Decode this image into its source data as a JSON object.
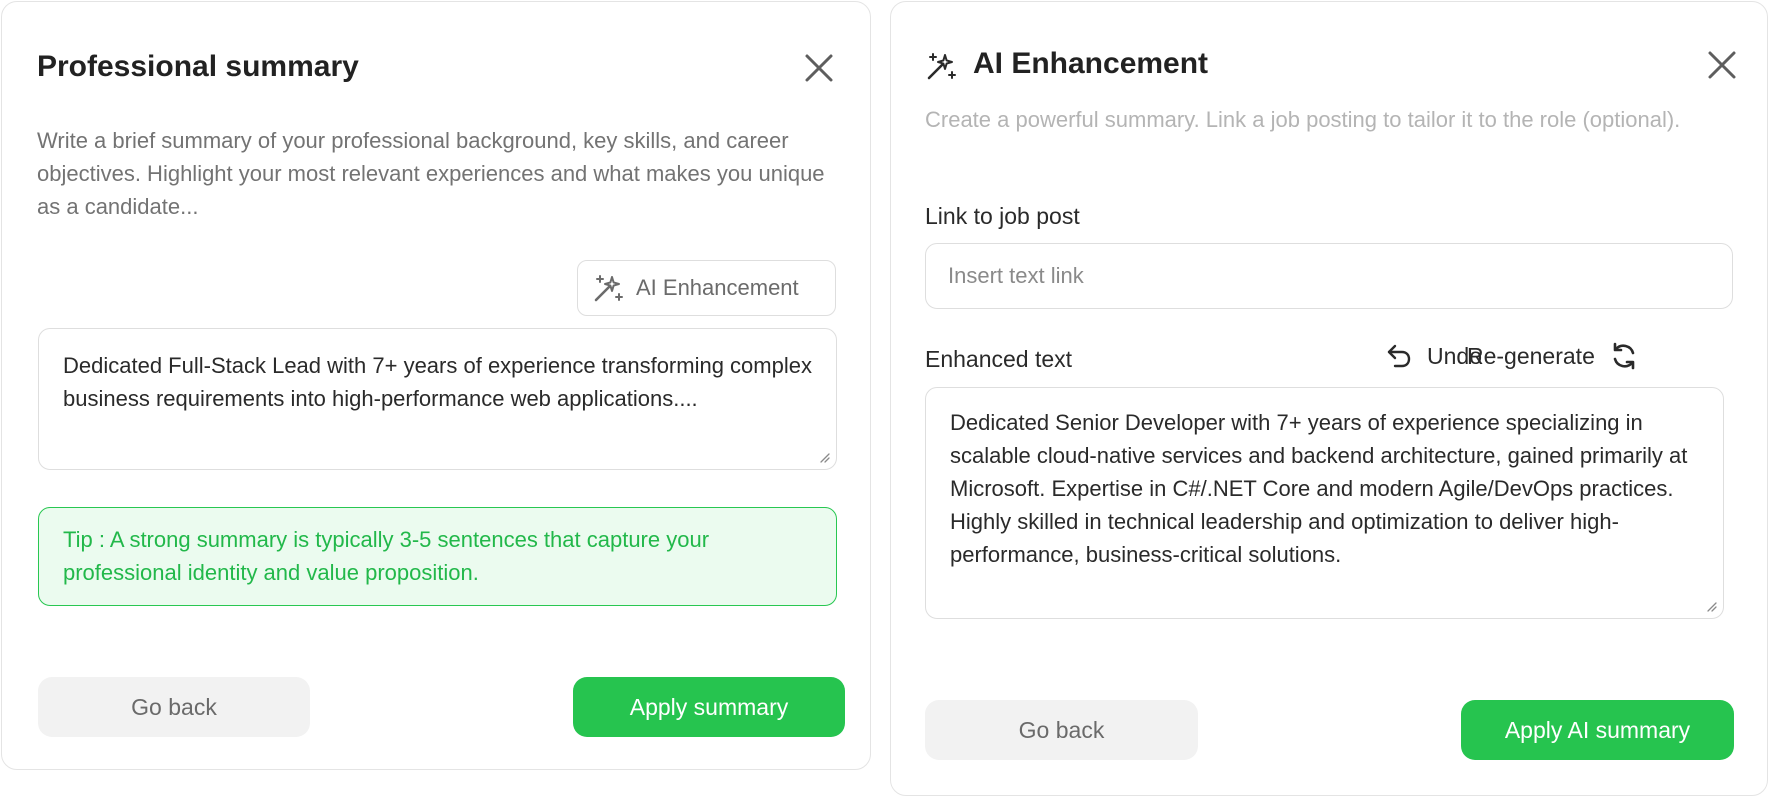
{
  "summary_panel": {
    "title": "Professional summary",
    "description": "Write a brief summary of your professional background, key skills, and career objectives. Highlight your most relevant experiences and what makes you unique as a candidate...",
    "ai_button_label": "AI Enhancement",
    "summary_text": "Dedicated Full-Stack Lead with 7+ years of experience transforming complex business requirements into high-performance web applications....",
    "tip_text": "Tip : A strong summary is typically 3-5 sentences that capture your professional identity and value proposition.",
    "go_back_label": "Go back",
    "apply_label": "Apply summary"
  },
  "enhancement_panel": {
    "title": "AI Enhancement",
    "description": "Create a powerful summary. Link a job posting to tailor it to the role (optional).",
    "link_label": "Link to job post",
    "link_placeholder": "Insert text link",
    "enhanced_label": "Enhanced text",
    "undo_label": "Undo",
    "regenerate_label": "Re-generate",
    "enhanced_text": "Dedicated Senior Developer with 7+ years of experience specializing in scalable cloud-native services and backend architecture, gained primarily at Microsoft. Expertise in C#/.NET Core and modern Agile/DevOps practices. Highly skilled in technical leadership and optimization to deliver high-performance, business-critical solutions.",
    "go_back_label": "Go back",
    "apply_label": "Apply AI summary"
  },
  "icons": {
    "close": "close-icon",
    "magic": "magic-wand-icon",
    "undo": "undo-icon",
    "regenerate": "refresh-icon",
    "resize": "resize-grip-icon"
  },
  "colors": {
    "accent": "#26c44f",
    "tip_background": "#ebfbef",
    "tip_text": "#22b84a"
  }
}
